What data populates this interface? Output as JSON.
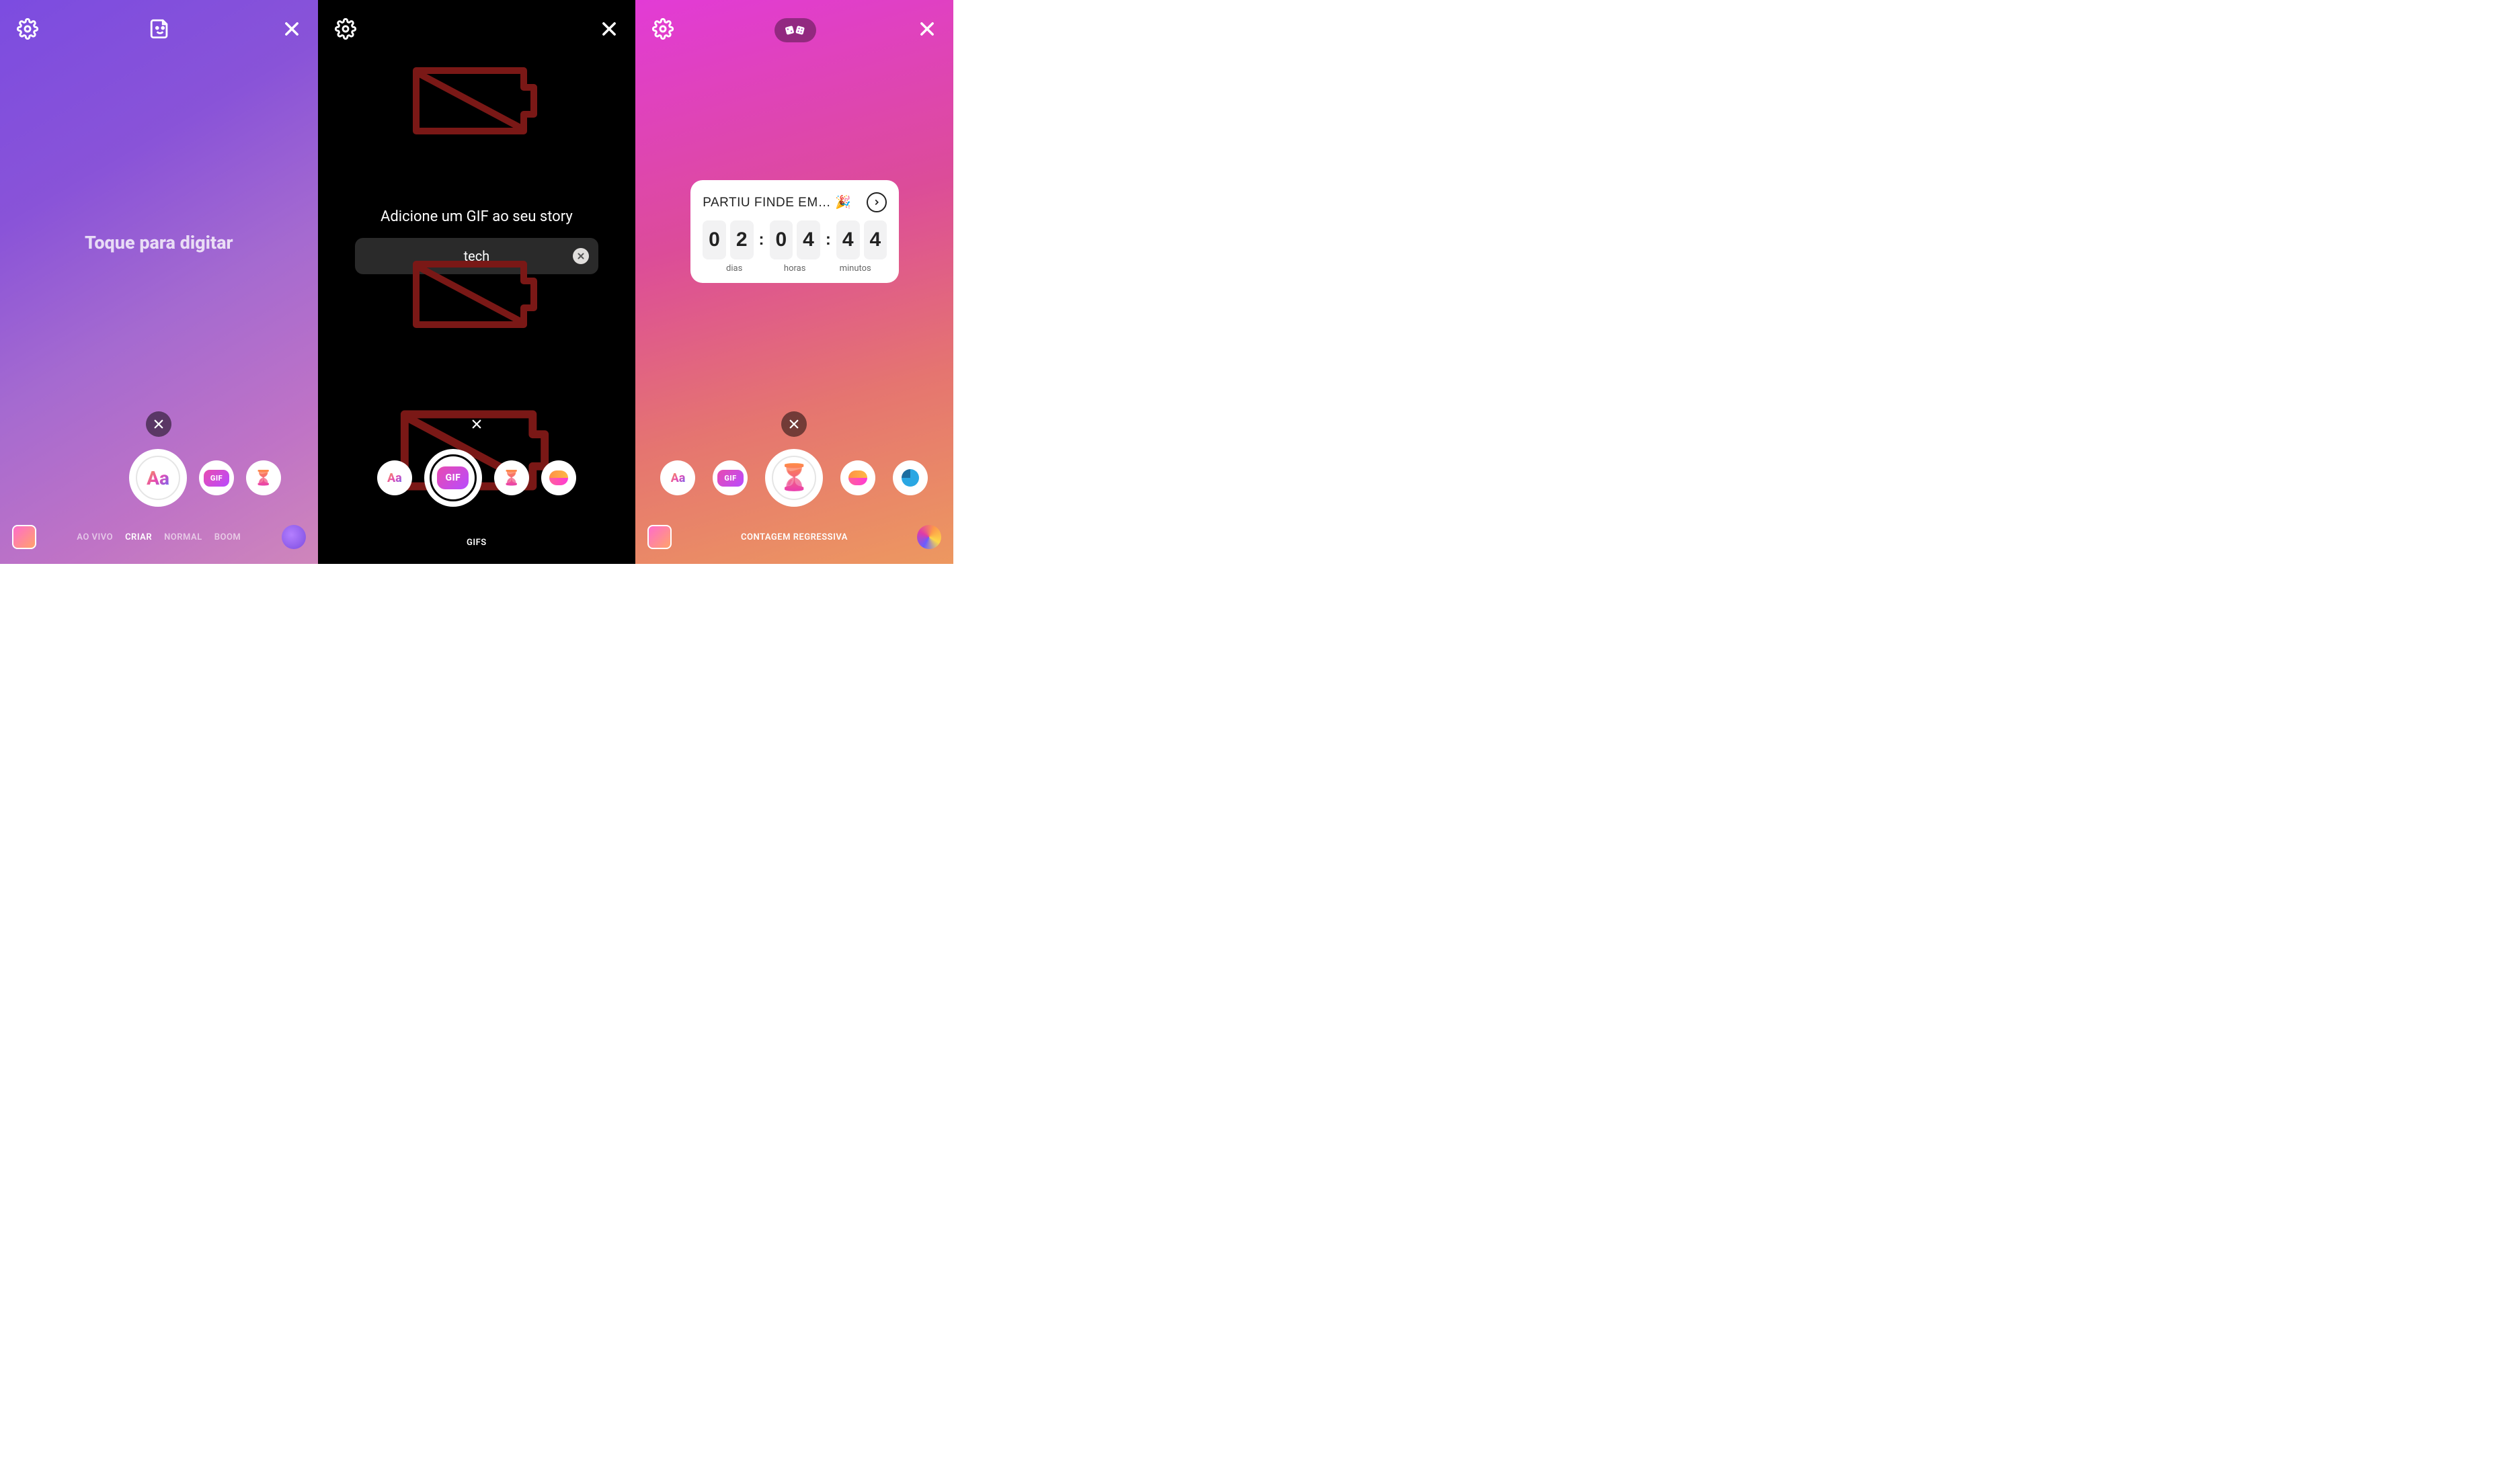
{
  "screen1": {
    "tap_prompt": "Toque para digitar",
    "modes": {
      "live": "AO VIVO",
      "create": "CRIAR",
      "normal": "NORMAL",
      "boom": "BOOM"
    },
    "create_chip_text": "Aa",
    "gif_chip_text": "GIF"
  },
  "screen2": {
    "title": "Adicione um GIF ao seu story",
    "search_value": "tech",
    "type_label": "Aa",
    "gif_label": "GIF",
    "bottom_label": "GIFS"
  },
  "screen3": {
    "countdown": {
      "title": "PARTIU FINDE EM… 🎉",
      "days_d1": "0",
      "days_d2": "2",
      "hours_d1": "0",
      "hours_d2": "4",
      "mins_d1": "4",
      "mins_d2": "4",
      "label_days": "dias",
      "label_hours": "horas",
      "label_minutes": "minutos"
    },
    "type_label": "Aa",
    "gif_label": "GIF",
    "bottom_label": "CONTAGEM REGRESSIVA"
  }
}
